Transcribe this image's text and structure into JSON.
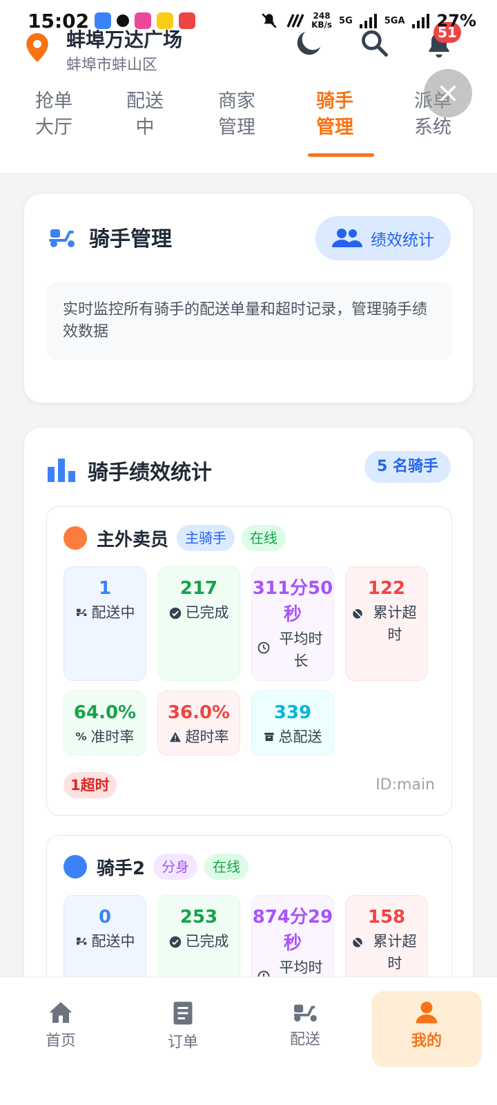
{
  "status_bar": {
    "time": "15:02",
    "net_speed_value": "248",
    "net_speed_unit": "KB/s",
    "signal_1": "5G",
    "signal_2": "5GA",
    "battery": "27%"
  },
  "header": {
    "location_name": "蚌埠万达广场",
    "location_sub": "蚌埠市蚌山区",
    "notification_count": "51"
  },
  "tabs": [
    {
      "label": "抢单\n大厅"
    },
    {
      "label": "配送\n中"
    },
    {
      "label": "商家\n管理"
    },
    {
      "label": "骑手\n管理"
    },
    {
      "label": "派单\n系统"
    }
  ],
  "active_tab": 3,
  "manage_card": {
    "title": "骑手管理",
    "action_label": "绩效统计",
    "description": "实时监控所有骑手的配送单量和超时记录，管理骑手绩效数据"
  },
  "stats_card": {
    "title": "骑手绩效统计",
    "count_label": "5 名骑手"
  },
  "riders": [
    {
      "name": "主外卖员",
      "role_tag": "主骑手",
      "status_tag": "在线",
      "stats": {
        "delivering": "1",
        "delivering_label": "配送中",
        "completed": "217",
        "completed_label": "已完成",
        "avg_time": "311分50秒",
        "avg_time_label": "平均时长",
        "timeouts": "122",
        "timeouts_label": "累计超时",
        "ontime_rate": "64.0%",
        "ontime_label": "准时率",
        "timeout_rate": "36.0%",
        "timeout_rate_label": "超时率",
        "total": "339",
        "total_label": "总配送"
      },
      "timeout_tag": "1超时",
      "id_text": "ID:main"
    },
    {
      "name": "骑手2",
      "role_tag": "分身",
      "status_tag": "在线",
      "stats": {
        "delivering": "0",
        "delivering_label": "配送中",
        "completed": "253",
        "completed_label": "已完成",
        "avg_time": "874分29秒",
        "avg_time_label": "平均时长",
        "timeouts": "158",
        "timeouts_label": "累计超时"
      }
    }
  ],
  "bottom_nav": [
    {
      "label": "首页"
    },
    {
      "label": "订单"
    },
    {
      "label": "配送"
    },
    {
      "label": "我的"
    }
  ],
  "colors": {
    "accent": "#f97316",
    "primary_blue": "#3b82f6",
    "rider1_dot": "#fb7c3c",
    "rider2_dot": "#3b82f6"
  }
}
